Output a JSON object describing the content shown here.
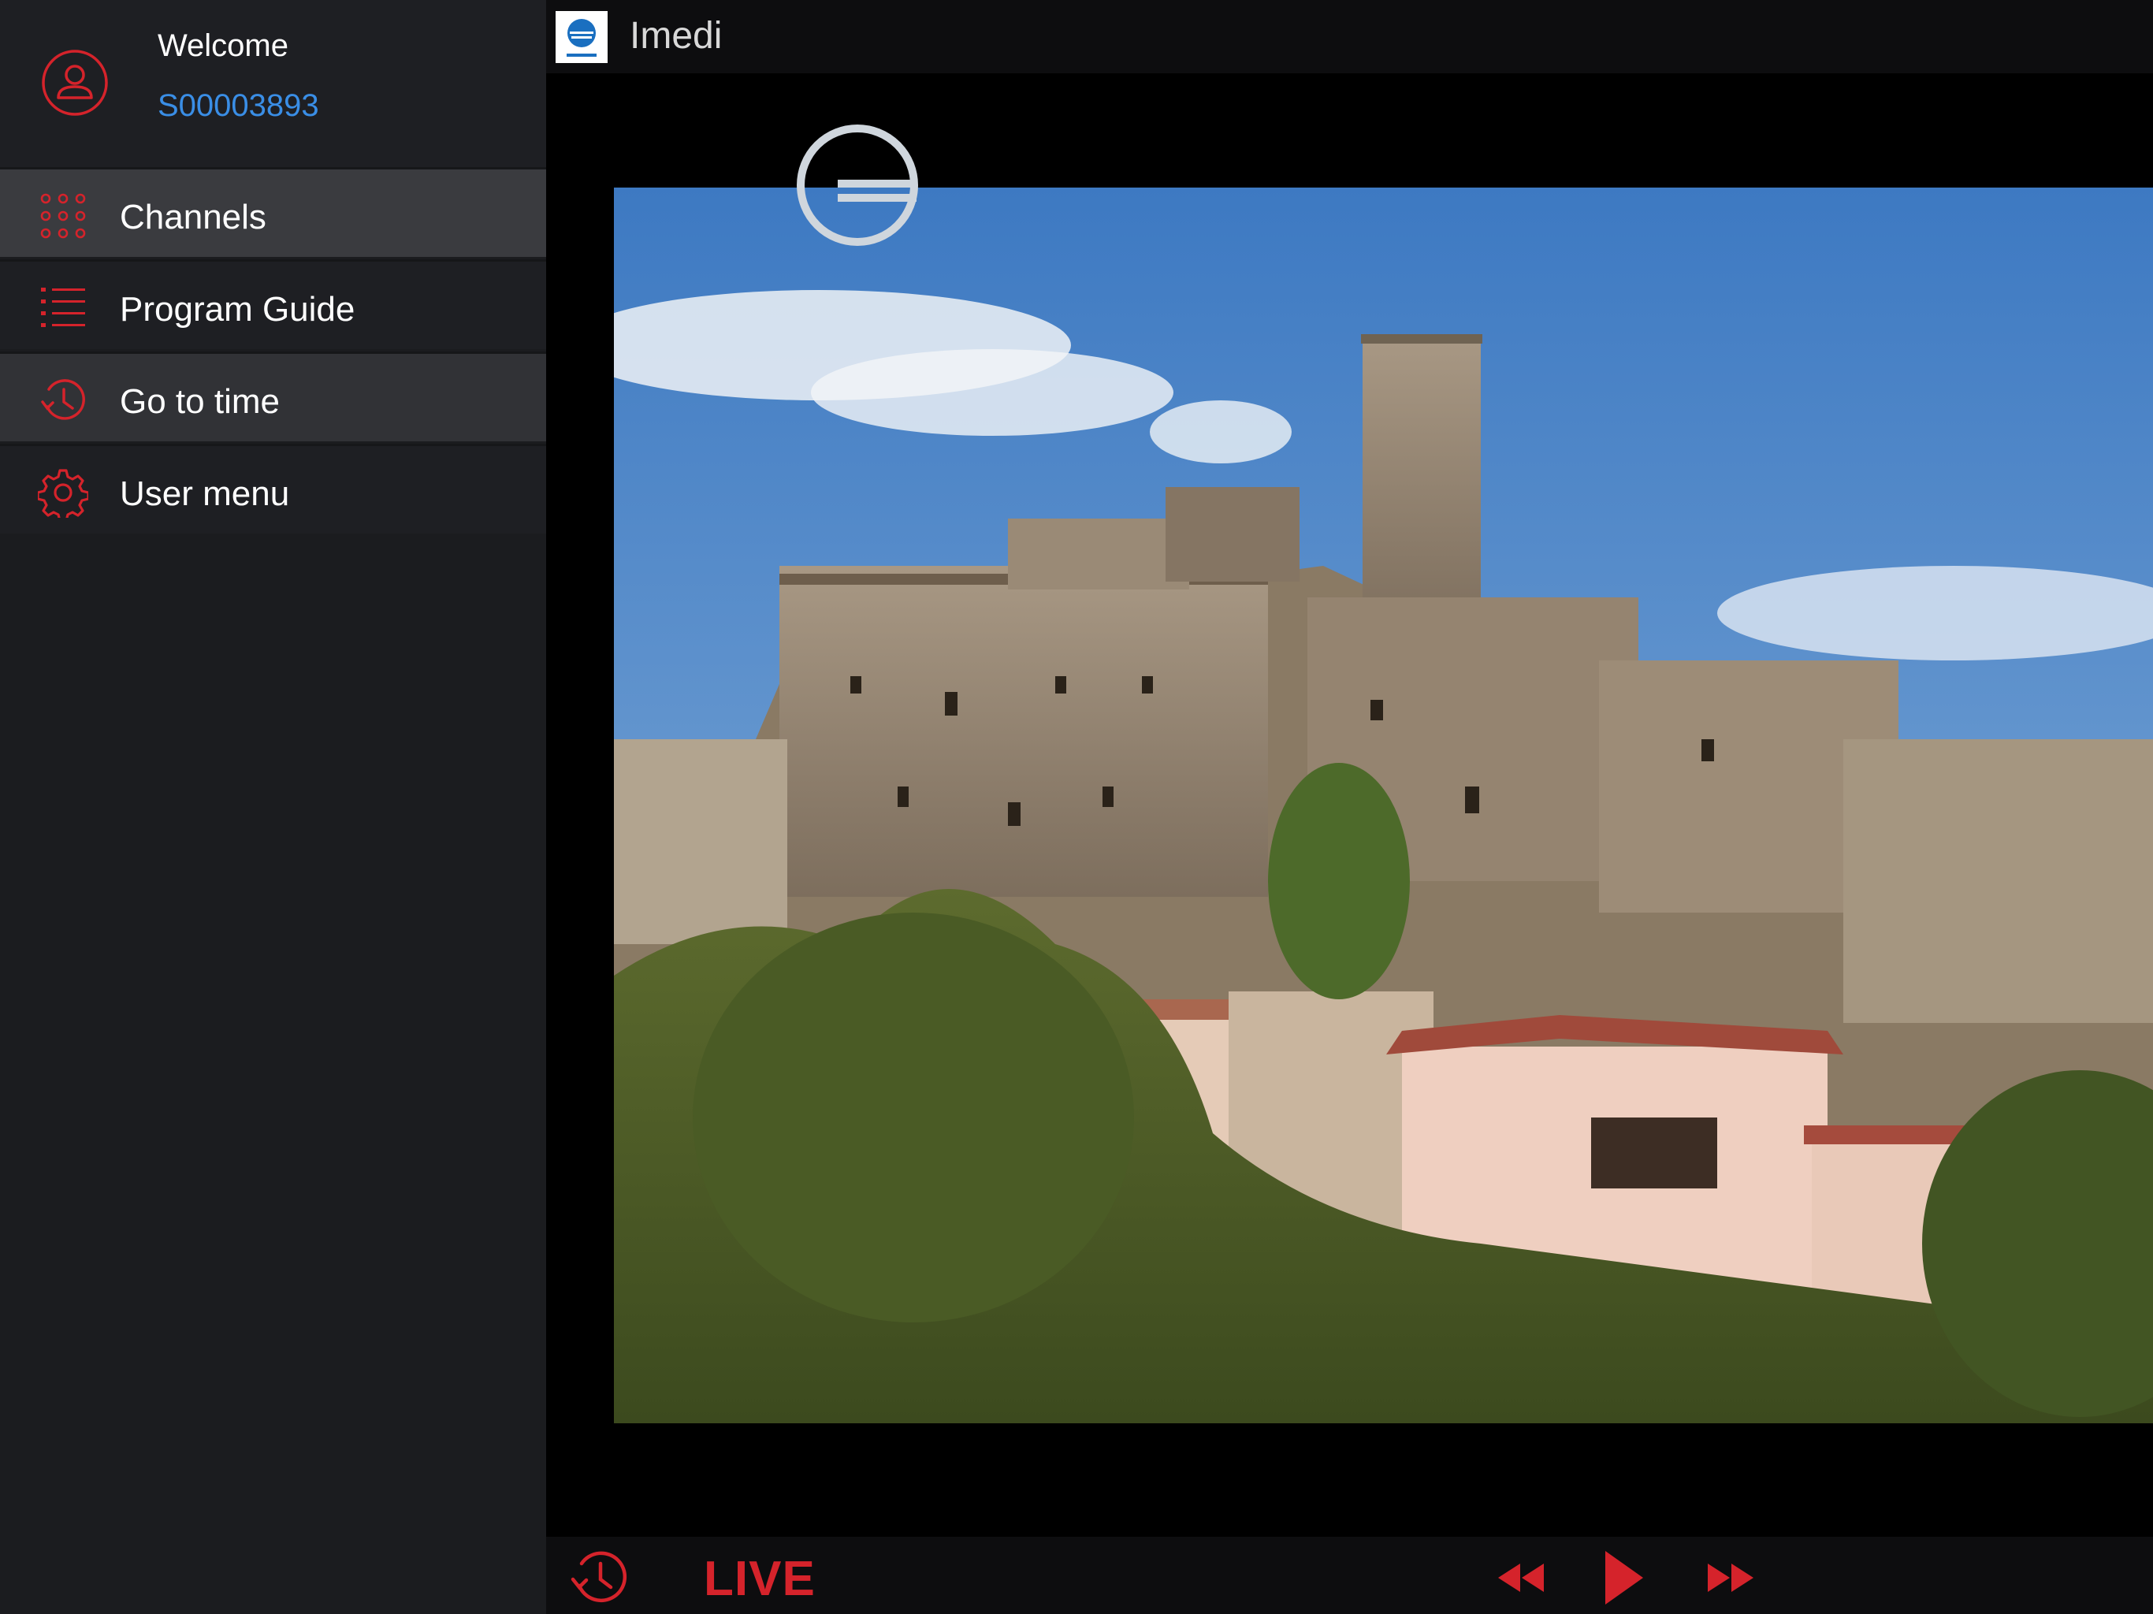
{
  "profile": {
    "welcome": "Welcome",
    "user_id": "S00003893"
  },
  "menu": {
    "items": [
      {
        "label": "Channels",
        "icon": "grid-icon",
        "state": "active"
      },
      {
        "label": "Program Guide",
        "icon": "list-icon",
        "state": "normal"
      },
      {
        "label": "Go to time",
        "icon": "clock-history-icon",
        "state": "hover"
      },
      {
        "label": "User menu",
        "icon": "gear-icon",
        "state": "normal"
      }
    ]
  },
  "player": {
    "channel_name": "Imedi",
    "live_label": "LIVE",
    "controls": [
      "history-icon",
      "rewind-icon",
      "play-icon",
      "fast-forward-icon"
    ]
  },
  "colors": {
    "accent_red": "#d5232b",
    "link_blue": "#3a8ee6",
    "sidebar_bg": "#1e1f23",
    "active_bg": "#3a3b3f"
  }
}
